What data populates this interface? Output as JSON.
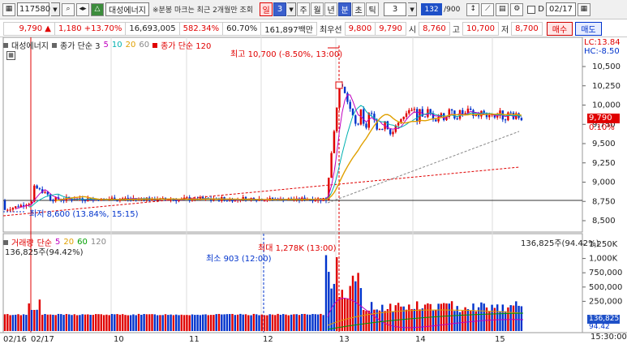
{
  "toolbar": {
    "stock_code": "117580",
    "stock_name": "대성에너지",
    "note": "※분봉 마크는 최근 2개월만 조회",
    "period_buttons": [
      {
        "label": "일",
        "state": "sel"
      },
      {
        "label": "3",
        "state": "active"
      },
      {
        "label": "주",
        "state": ""
      },
      {
        "label": "월",
        "state": ""
      },
      {
        "label": "년",
        "state": ""
      },
      {
        "label": "분",
        "state": "active"
      },
      {
        "label": "초",
        "state": ""
      },
      {
        "label": "틱",
        "state": ""
      }
    ],
    "interval": "3",
    "count_badge": "132",
    "count_total": "/900",
    "date": "02/17"
  },
  "quote": {
    "price": "9,790 ▲",
    "change": "1,180 +13.70%",
    "volume": "16,693,005",
    "volume_ratio": "582.34%",
    "turnover_pct": "60.70%",
    "amount": "161,897백만",
    "pref_label": "최우선",
    "pref_value": "9,800",
    "pref_value2": "9,790",
    "open_label": "시",
    "open": "8,760",
    "high_label": "고",
    "high": "10,700",
    "low_label": "저",
    "low": "8,700",
    "buy": "매수",
    "sell": "매도"
  },
  "price_panel": {
    "legend_name": "대성에너지",
    "legend_ma": "종가 단순 3",
    "legend_periods": [
      "5",
      "10",
      "20",
      "60"
    ],
    "legend_ma2": "종가 단순 120",
    "high_annotation": "최고 10,700 (-8.50%, 13:00)",
    "low_annotation": "최저 8,600 (13.84%, 15:15)",
    "lc": "LC:13.84",
    "hc": "HC:-8.50",
    "current_price": "9,790",
    "current_pct": "0.10%",
    "y_ticks": [
      "10,500",
      "10,250",
      "10,000",
      "9,750",
      "9,500",
      "9,250",
      "9,000",
      "8,750",
      "8,500"
    ]
  },
  "volume_panel": {
    "legend_name": "거래량",
    "legend_ma": "단순",
    "legend_periods": [
      "5",
      "20",
      "60",
      "120"
    ],
    "sub_value": "136,825주(94.42%)",
    "right_value": "136,825주(94.42%)",
    "max_annotation": "최대 1,278K (13:00)",
    "min_annotation": "최소 903 (12:00)",
    "y_ticks": [
      "1,250K",
      "1,000K",
      "750,000",
      "500,000",
      "250,000"
    ],
    "current_volume": "136,825",
    "current_pct": "94.42"
  },
  "x_axis": {
    "labels": [
      "02/16",
      "02/17",
      "10",
      "11",
      "12",
      "13",
      "14",
      "15"
    ],
    "time": "15:30:00"
  },
  "colors": {
    "up": "#e00000",
    "down": "#0033cc",
    "ma3": "#e05050",
    "ma5": "#c000c0",
    "ma10": "#00b0b0",
    "ma20": "#e0a000",
    "ma60": "#00a000"
  }
}
